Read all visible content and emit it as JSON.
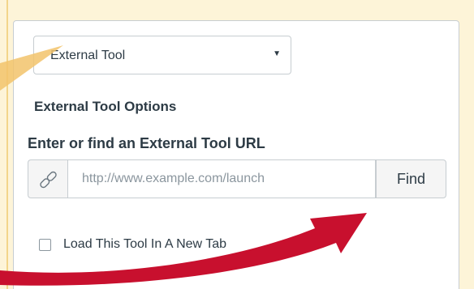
{
  "tool_select": {
    "value": "External Tool",
    "arrow_icon": "caret-down-icon"
  },
  "options_heading": "External Tool Options",
  "url_label": "Enter or find an External Tool URL",
  "url_input": {
    "placeholder": "http://www.example.com/launch",
    "value": "",
    "link_icon": "link-icon"
  },
  "find_button": "Find",
  "new_tab_checkbox": {
    "label": "Load This Tool In A New Tab",
    "checked": false
  },
  "annotations": {
    "arrow_color": "#c8102e",
    "pointer_color": "#f2c36b"
  },
  "colors": {
    "page_background": "#fdf4d8",
    "text": "#2d3b45",
    "border": "#c7cdd1",
    "addon_background": "#f5f5f5"
  }
}
